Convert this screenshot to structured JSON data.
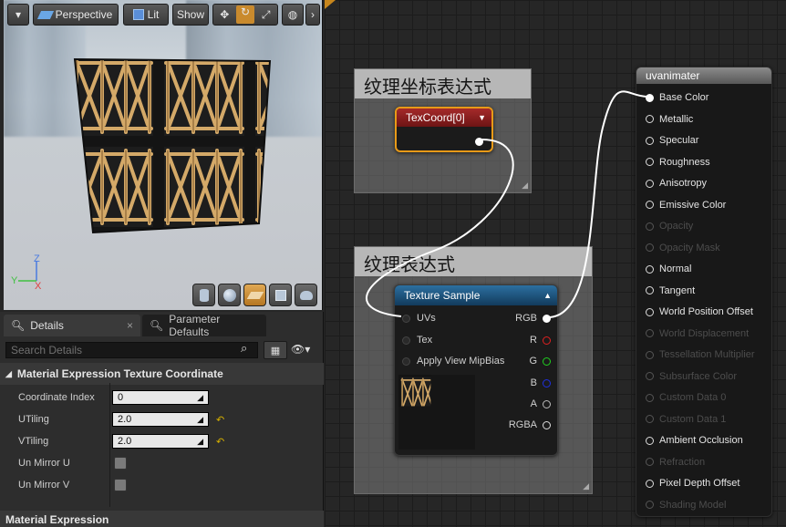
{
  "viewport": {
    "view_mode": "Perspective",
    "lit_mode": "Lit",
    "show_label": "Show",
    "axis_z": "Z",
    "axis_y": "Y",
    "axis_x": "X"
  },
  "details": {
    "tabs": [
      {
        "label": "Details",
        "active": true
      },
      {
        "label": "Parameter Defaults",
        "active": false
      }
    ],
    "search_placeholder": "Search Details",
    "section_title": "Material Expression Texture Coordinate",
    "properties": [
      {
        "label": "Coordinate Index",
        "value": "0"
      },
      {
        "label": "UTiling",
        "value": "2.0"
      },
      {
        "label": "VTiling",
        "value": "2.0"
      },
      {
        "label": "Un Mirror U",
        "checked": false
      },
      {
        "label": "Un Mirror V",
        "checked": false
      }
    ],
    "section2_title": "Material Expression"
  },
  "graph": {
    "comment1_title": "纹理坐标表达式",
    "comment2_title": "纹理表达式",
    "texcoord_title": "TexCoord[0]",
    "texture_sample": {
      "title": "Texture Sample",
      "inputs": [
        "UVs",
        "Tex",
        "Apply View MipBias"
      ],
      "outputs": [
        {
          "label": "RGB",
          "color": "#ffffff"
        },
        {
          "label": "R",
          "color": "#e02020"
        },
        {
          "label": "G",
          "color": "#20d020"
        },
        {
          "label": "B",
          "color": "#2030e0"
        },
        {
          "label": "A",
          "color": "#bbbbbb"
        },
        {
          "label": "RGBA",
          "color": "#dddddd"
        }
      ]
    },
    "material": {
      "title": "uvanimater",
      "pins": [
        {
          "label": "Base Color",
          "state": "connected"
        },
        {
          "label": "Metallic",
          "state": "active"
        },
        {
          "label": "Specular",
          "state": "active"
        },
        {
          "label": "Roughness",
          "state": "active"
        },
        {
          "label": "Anisotropy",
          "state": "active"
        },
        {
          "label": "Emissive Color",
          "state": "active"
        },
        {
          "label": "Opacity",
          "state": "disabled"
        },
        {
          "label": "Opacity Mask",
          "state": "disabled"
        },
        {
          "label": "Normal",
          "state": "active"
        },
        {
          "label": "Tangent",
          "state": "active"
        },
        {
          "label": "World Position Offset",
          "state": "active"
        },
        {
          "label": "World Displacement",
          "state": "disabled"
        },
        {
          "label": "Tessellation Multiplier",
          "state": "disabled"
        },
        {
          "label": "Subsurface Color",
          "state": "disabled"
        },
        {
          "label": "Custom Data 0",
          "state": "disabled"
        },
        {
          "label": "Custom Data 1",
          "state": "disabled"
        },
        {
          "label": "Ambient Occlusion",
          "state": "active"
        },
        {
          "label": "Refraction",
          "state": "disabled"
        },
        {
          "label": "Pixel Depth Offset",
          "state": "active"
        },
        {
          "label": "Shading Model",
          "state": "disabled"
        }
      ]
    }
  }
}
